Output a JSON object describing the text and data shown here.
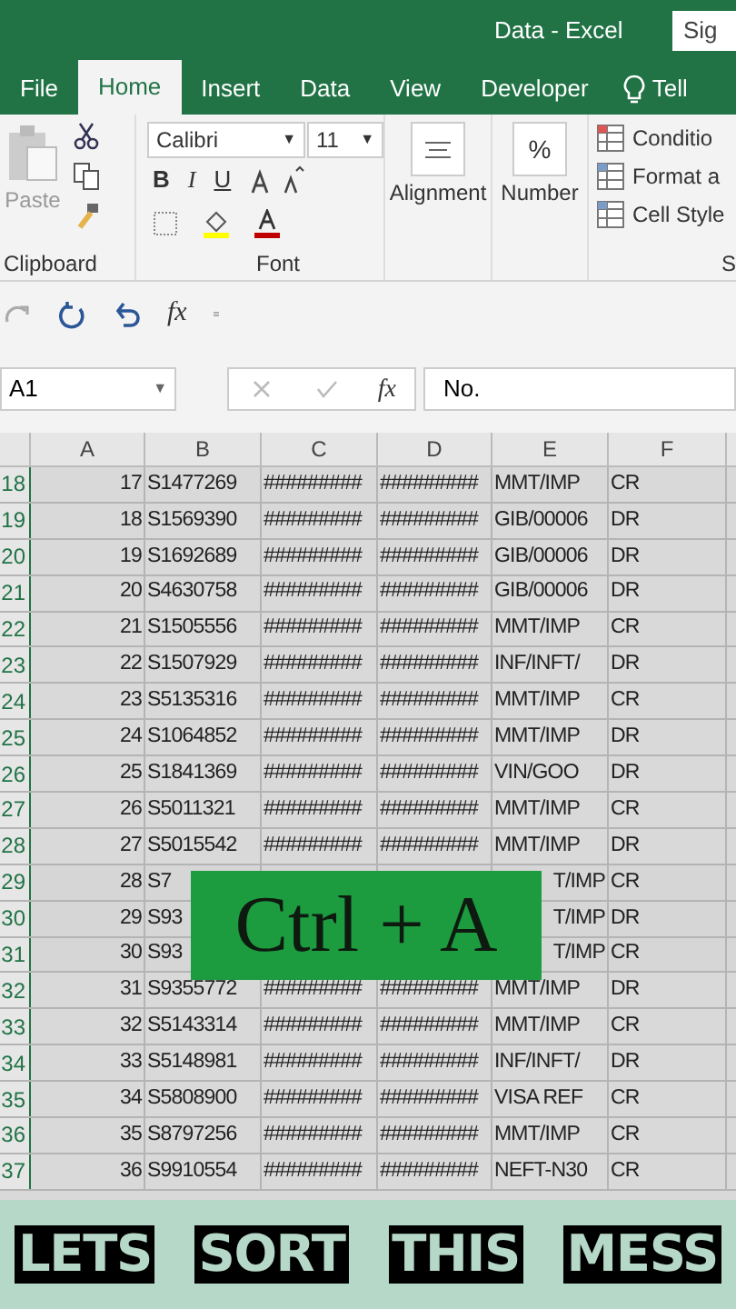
{
  "window": {
    "title": "Data - Excel",
    "sign_in": "Sig"
  },
  "tabs": [
    {
      "label": "File",
      "selected": false
    },
    {
      "label": "Home",
      "selected": true
    },
    {
      "label": "Insert",
      "selected": false
    },
    {
      "label": "Data",
      "selected": false
    },
    {
      "label": "View",
      "selected": false
    },
    {
      "label": "Developer",
      "selected": false
    }
  ],
  "tell_me": "Tell",
  "ribbon": {
    "clipboard": {
      "paste": "Paste",
      "label": "Clipboard"
    },
    "font": {
      "name": "Calibri",
      "size": "11",
      "bold": "B",
      "italic": "I",
      "underline": "U",
      "label": "Font"
    },
    "alignment": "Alignment",
    "number": "Number",
    "styles": [
      "Conditio",
      "Format a",
      "Cell Style"
    ],
    "styles_label": "S"
  },
  "name_box": "A1",
  "formula": "No.",
  "function_symbol": "fx",
  "formula_function_symbol": "fx",
  "font_name_dropdown": "▼",
  "font_size_dropdown": "▼",
  "name_box_dropdown": "▼",
  "percent_symbol": "%",
  "columns": [
    "A",
    "B",
    "C",
    "D",
    "E",
    "F"
  ],
  "rows": [
    {
      "num": "18",
      "cells": [
        "17",
        "S1477269",
        "#########",
        "#########",
        "MMT/IMP",
        "CR"
      ],
      "covered": false
    },
    {
      "num": "19",
      "cells": [
        "18",
        "S1569390",
        "#########",
        "#########",
        "GIB/00006",
        "DR"
      ],
      "covered": false
    },
    {
      "num": "20",
      "cells": [
        "19",
        "S1692689",
        "#########",
        "#########",
        "GIB/00006",
        "DR"
      ],
      "covered": false
    },
    {
      "num": "21",
      "cells": [
        "20",
        "S4630758",
        "#########",
        "#########",
        "GIB/00006",
        "DR"
      ],
      "covered": false
    },
    {
      "num": "22",
      "cells": [
        "21",
        "S1505556",
        "#########",
        "#########",
        "MMT/IMP",
        "CR"
      ],
      "covered": false
    },
    {
      "num": "23",
      "cells": [
        "22",
        "S1507929",
        "#########",
        "#########",
        "INF/INFT/",
        "DR"
      ],
      "covered": false
    },
    {
      "num": "24",
      "cells": [
        "23",
        "S5135316",
        "#########",
        "#########",
        "MMT/IMP",
        "CR"
      ],
      "covered": false
    },
    {
      "num": "25",
      "cells": [
        "24",
        "S1064852",
        "#########",
        "#########",
        "MMT/IMP",
        "DR"
      ],
      "covered": false
    },
    {
      "num": "26",
      "cells": [
        "25",
        "S1841369",
        "#########",
        "#########",
        "VIN/GOO",
        "DR"
      ],
      "covered": false
    },
    {
      "num": "27",
      "cells": [
        "26",
        "S5011321",
        "#########",
        "#########",
        "MMT/IMP",
        "CR"
      ],
      "covered": false
    },
    {
      "num": "28",
      "cells": [
        "27",
        "S5015542",
        "#########",
        "#########",
        "MMT/IMP",
        "DR"
      ],
      "covered": false
    },
    {
      "num": "29",
      "cells": [
        "28",
        "S7",
        "",
        "",
        "T/IMP",
        "CR"
      ],
      "covered": true
    },
    {
      "num": "30",
      "cells": [
        "29",
        "S93",
        "",
        "",
        "T/IMP",
        "DR"
      ],
      "covered": true
    },
    {
      "num": "31",
      "cells": [
        "30",
        "S93",
        "",
        "",
        "T/IMP",
        "CR"
      ],
      "covered": true
    },
    {
      "num": "32",
      "cells": [
        "31",
        "S9355772",
        "#########",
        "#########",
        "MMT/IMP",
        "DR"
      ],
      "covered": false
    },
    {
      "num": "33",
      "cells": [
        "32",
        "S5143314",
        "#########",
        "#########",
        "MMT/IMP",
        "CR"
      ],
      "covered": false
    },
    {
      "num": "34",
      "cells": [
        "33",
        "S5148981",
        "#########",
        "#########",
        "INF/INFT/",
        "DR"
      ],
      "covered": false
    },
    {
      "num": "35",
      "cells": [
        "34",
        "S5808900",
        "#########",
        "#########",
        "VISA REF",
        "CR"
      ],
      "covered": false
    },
    {
      "num": "36",
      "cells": [
        "35",
        "S8797256",
        "#########",
        "#########",
        "MMT/IMP",
        "CR"
      ],
      "covered": false
    },
    {
      "num": "37",
      "cells": [
        "36",
        "S9910554",
        "#########",
        "#########",
        "NEFT-N30",
        "CR"
      ],
      "covered": false
    }
  ],
  "overlay": "Ctrl + A",
  "caption": [
    "LETS",
    "SORT",
    "THIS",
    "MESS"
  ]
}
